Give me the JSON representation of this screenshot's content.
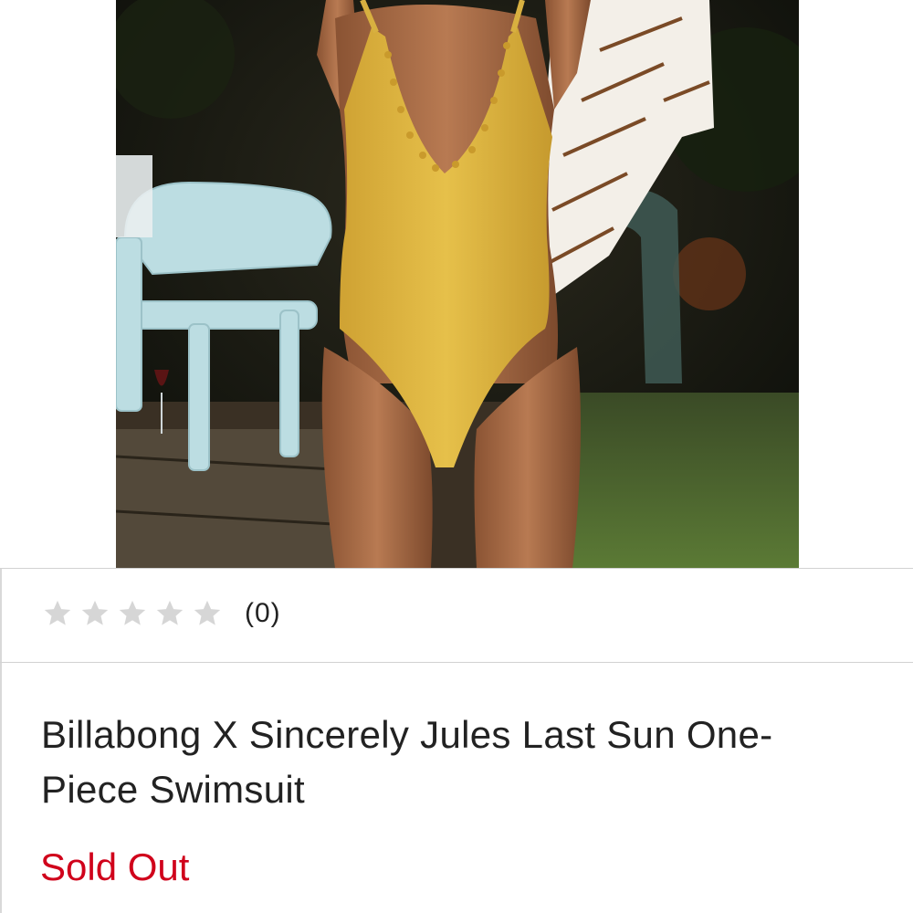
{
  "product": {
    "image": {
      "description_icon": "product-photo",
      "swimsuit_color": "#e0b53c"
    },
    "rating": {
      "stars_total": 5,
      "stars_filled": 0,
      "count_label": "(0)",
      "star_color": "#d6d6d6"
    },
    "title": "Billabong X Sincerely Jules Last Sun One-Piece Swimsuit",
    "availability": {
      "label": "Sold Out",
      "color": "#d0021b"
    }
  }
}
